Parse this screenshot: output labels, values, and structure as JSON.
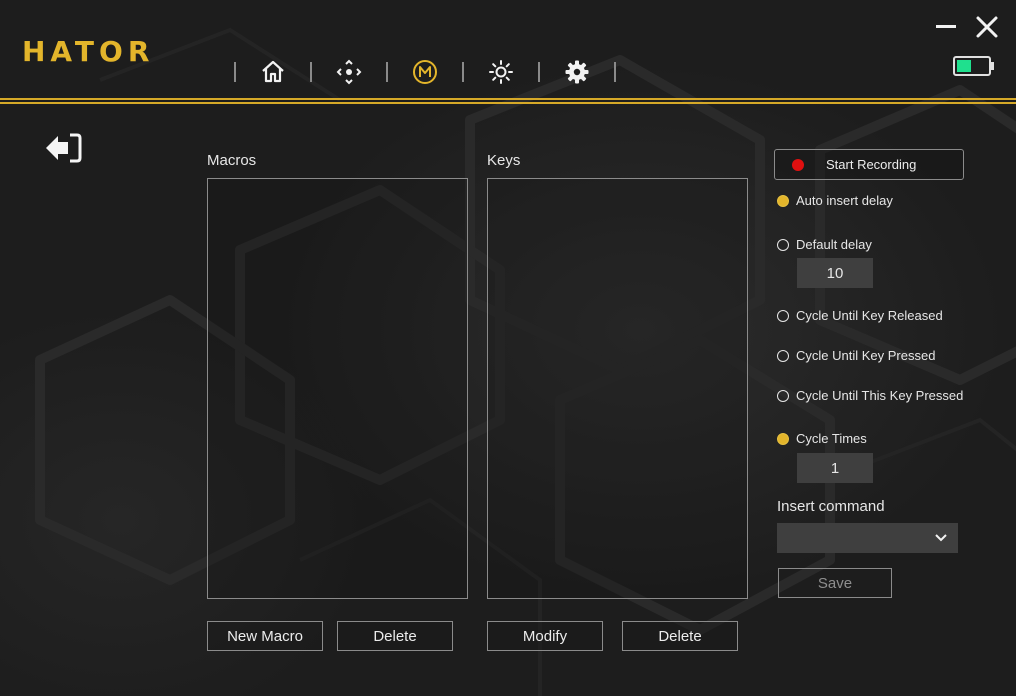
{
  "app": {
    "logo": "HATOR"
  },
  "nav": {
    "items": [
      {
        "icon": "home-icon"
      },
      {
        "icon": "move-arrows-icon"
      },
      {
        "icon": "macro-m-icon",
        "active": true
      },
      {
        "icon": "brightness-icon"
      },
      {
        "icon": "gear-icon"
      }
    ]
  },
  "colors": {
    "accent": "#e3b52b",
    "record": "#e01010",
    "battery": "#1fe08e",
    "field": "#3f3f3f"
  },
  "macros": {
    "title": "Macros",
    "items": [],
    "new_label": "New Macro",
    "delete_label": "Delete"
  },
  "keys": {
    "title": "Keys",
    "items": [],
    "modify_label": "Modify",
    "delete_label": "Delete"
  },
  "recording": {
    "label": "Start Recording"
  },
  "delay": {
    "auto_label": "Auto insert delay",
    "default_label": "Default delay",
    "default_value": "10"
  },
  "cycle": {
    "released_label": "Cycle Until Key Released",
    "pressed_label": "Cycle Until Key Pressed",
    "this_key_label": "Cycle Until This Key Pressed",
    "times_label": "Cycle Times",
    "times_value": "1"
  },
  "insert": {
    "label": "Insert command",
    "selected": ""
  },
  "save_label": "Save"
}
